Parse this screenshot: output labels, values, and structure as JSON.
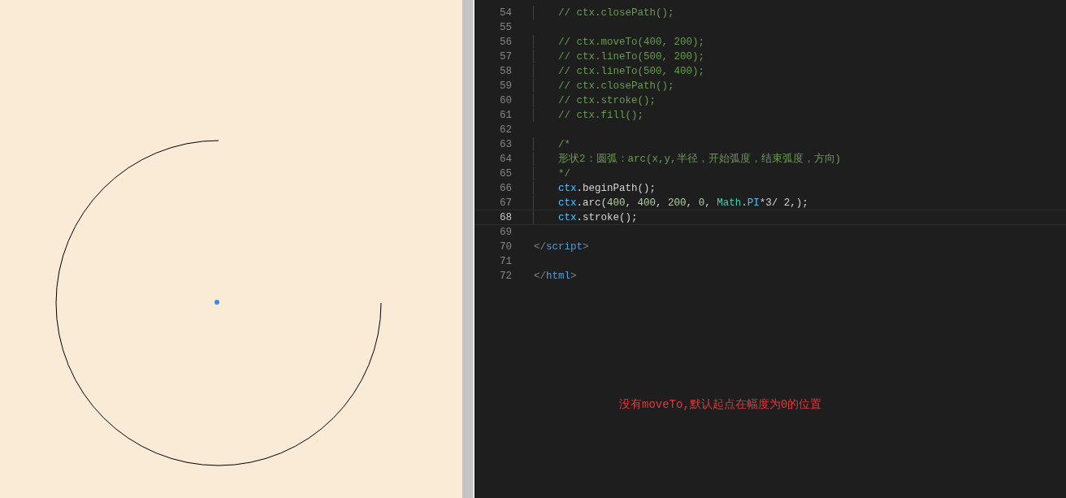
{
  "editor": {
    "lines": [
      {
        "number": "54",
        "current": false,
        "tokens": [
          {
            "t": "    // ctx.closePath();",
            "kind": "comment"
          }
        ]
      },
      {
        "number": "55",
        "current": false
      },
      {
        "number": "56",
        "current": false,
        "tokens": [
          {
            "t": "    // ctx.moveTo(400, 200);",
            "kind": "comment"
          }
        ]
      },
      {
        "number": "57",
        "current": false,
        "tokens": [
          {
            "t": "    // ctx.lineTo(500, 200);",
            "kind": "comment"
          }
        ]
      },
      {
        "number": "58",
        "current": false,
        "tokens": [
          {
            "t": "    // ctx.lineTo(500, 400);",
            "kind": "comment"
          }
        ]
      },
      {
        "number": "59",
        "current": false,
        "tokens": [
          {
            "t": "    // ctx.closePath();",
            "kind": "comment"
          }
        ]
      },
      {
        "number": "60",
        "current": false,
        "tokens": [
          {
            "t": "    // ctx.stroke();",
            "kind": "comment"
          }
        ]
      },
      {
        "number": "61",
        "current": false,
        "tokens": [
          {
            "t": "    // ctx.fill();",
            "kind": "comment"
          }
        ]
      },
      {
        "number": "62",
        "current": false
      },
      {
        "number": "63",
        "current": false,
        "tokens": [
          {
            "t": "    /*",
            "kind": "comment"
          }
        ]
      },
      {
        "number": "64",
        "current": false,
        "tokens": [
          {
            "t": "    形状2：圆弧：arc(x,y,半径，开始弧度，结束弧度，方向)",
            "kind": "comment"
          }
        ]
      },
      {
        "number": "65",
        "current": false,
        "tokens": [
          {
            "t": "    */",
            "kind": "comment"
          }
        ]
      },
      {
        "number": "66",
        "current": false,
        "tokens": [
          {
            "t": "    ctx",
            "kind": "var"
          },
          {
            "t": ".beginPath();",
            "kind": "plain"
          }
        ]
      },
      {
        "number": "67",
        "current": false,
        "tokens": [
          {
            "t": "    ctx",
            "kind": "var"
          },
          {
            "t": ".arc(",
            "kind": "plain"
          },
          {
            "t": "400",
            "kind": "num"
          },
          {
            "t": ", ",
            "kind": "plain"
          },
          {
            "t": "400",
            "kind": "num"
          },
          {
            "t": ", ",
            "kind": "plain"
          },
          {
            "t": "200",
            "kind": "num"
          },
          {
            "t": ", ",
            "kind": "plain"
          },
          {
            "t": "0",
            "kind": "num"
          },
          {
            "t": ", ",
            "kind": "plain"
          },
          {
            "t": "Math",
            "kind": "class"
          },
          {
            "t": ".",
            "kind": "plain"
          },
          {
            "t": "PI",
            "kind": "var"
          },
          {
            "t": "*3/ 2,);",
            "kind": "plain"
          }
        ]
      },
      {
        "number": "68",
        "current": true,
        "tokens": [
          {
            "t": "    ctx",
            "kind": "var"
          },
          {
            "t": ".stroke();",
            "kind": "plain"
          }
        ]
      },
      {
        "number": "69",
        "current": false
      },
      {
        "number": "70",
        "current": false,
        "tokens": [
          {
            "t": "</",
            "kind": "bracket"
          },
          {
            "t": "script",
            "kind": "tag"
          },
          {
            "t": ">",
            "kind": "bracket"
          }
        ]
      },
      {
        "number": "71",
        "current": false
      },
      {
        "number": "72",
        "current": false,
        "tokens": [
          {
            "t": "</",
            "kind": "bracket"
          },
          {
            "t": "html",
            "kind": "tag"
          },
          {
            "t": ">",
            "kind": "bracket"
          }
        ]
      }
    ]
  },
  "annotation": "没有moveTo,默认起点在幅度为0的位置"
}
